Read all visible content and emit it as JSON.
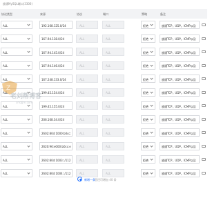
{
  "hint": "放通MySQL端口(3306)",
  "columns": {
    "type": "协议类型",
    "source": "来源",
    "protocol": "协议",
    "port": "端口",
    "policy": "策略",
    "remark": "备注"
  },
  "rows": [
    {
      "type": "ALL",
      "source": "192.168.125.0/24",
      "protocol": "ALL",
      "port": "ALL",
      "policy": "拒绝",
      "remark": "放通TCP，UDP，ICMP以及"
    },
    {
      "type": "ALL",
      "source": "167.94.138.0/24",
      "protocol": "ALL",
      "port": "ALL",
      "policy": "拒绝",
      "remark": "放通TCP，UDP，ICMP以及"
    },
    {
      "type": "ALL",
      "source": "167.94.145.0/24",
      "protocol": "ALL",
      "port": "ALL",
      "policy": "拒绝",
      "remark": "放通TCP，UDP，ICMP以及"
    },
    {
      "type": "ALL",
      "source": "167.94.146.0/24",
      "protocol": "ALL",
      "port": "ALL",
      "policy": "拒绝",
      "remark": "放通TCP，UDP，ICMP以及"
    },
    {
      "type": "ALL",
      "source": "167.248.133.0/24",
      "protocol": "ALL",
      "port": "ALL",
      "policy": "拒绝",
      "remark": "放通TCP，UDP，ICMP以及"
    },
    {
      "type": "ALL",
      "source": "199.45.154.0/24",
      "protocol": "ALL",
      "port": "ALL",
      "policy": "拒绝",
      "remark": "放通TCP，UDP，ICMP以及"
    },
    {
      "type": "ALL",
      "source": "199.45.155.0/24",
      "protocol": "ALL",
      "port": "ALL",
      "policy": "拒绝",
      "remark": "放通TCP，UDP，ICMP以及"
    },
    {
      "type": "ALL",
      "source": "206.168.34.0/24",
      "protocol": "ALL",
      "port": "ALL",
      "policy": "拒绝",
      "remark": "放通TCP，UDP，ICMP以及"
    },
    {
      "type": "ALL",
      "source": "2602:80d:1000:b0cc:",
      "protocol": "ALL",
      "port": "ALL",
      "policy": "拒绝",
      "remark": "放通TCP，UDP，ICMP以及"
    },
    {
      "type": "ALL",
      "source": "2620:96:e000:b0cc:e",
      "protocol": "ALL",
      "port": "ALL",
      "policy": "拒绝",
      "remark": "放通TCP，UDP，ICMP以及"
    },
    {
      "type": "ALL",
      "source": "2602:80d:1003::/112",
      "protocol": "ALL",
      "port": "ALL",
      "policy": "拒绝",
      "remark": "放通TCP，UDP，ICMP以及"
    },
    {
      "type": "ALL",
      "source": "2602:80d:1004::/112",
      "protocol": "ALL",
      "port": "ALL",
      "policy": "拒绝",
      "remark": "放通TCP，UDP，ICMP以及"
    }
  ],
  "add": {
    "label": "新增一条",
    "tip": "您还可增加 40 条"
  },
  "watermark": {
    "text": "老刘帮博客",
    "sub": "cmzjjm.com"
  },
  "colors": {
    "accent": "#1f6fff",
    "header_bg": "#f2f3f5",
    "disabled_bg": "#f0f1f3"
  }
}
